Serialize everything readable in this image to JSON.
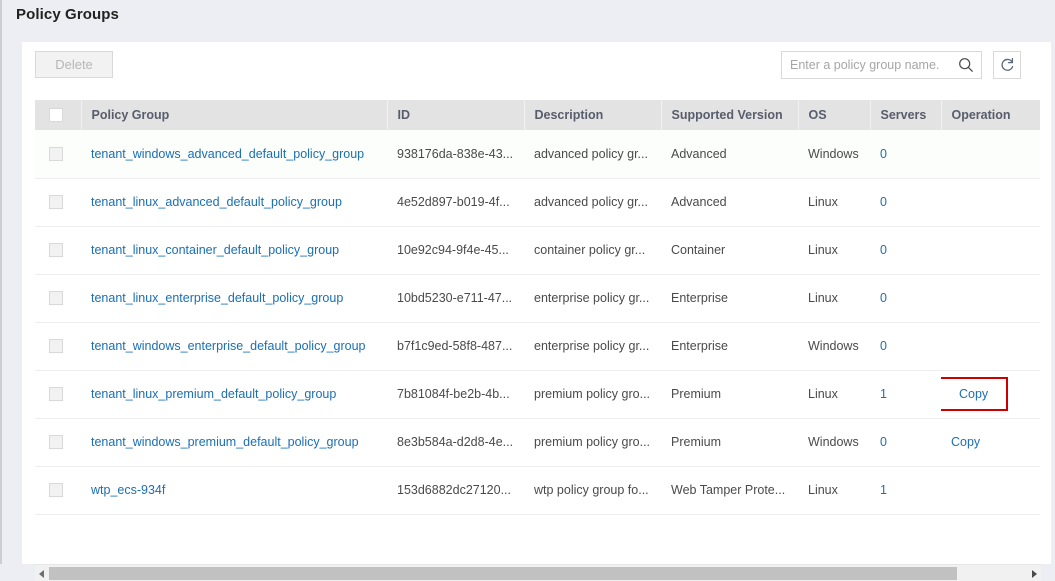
{
  "page": {
    "title": "Policy Groups"
  },
  "toolbar": {
    "delete_label": "Delete",
    "search_placeholder": "Enter a policy group name.",
    "search_value": "",
    "search_icon": "search-icon",
    "refresh_icon": "refresh-icon"
  },
  "table": {
    "columns": [
      {
        "key": "checkbox",
        "label": ""
      },
      {
        "key": "name",
        "label": "Policy Group"
      },
      {
        "key": "id",
        "label": "ID"
      },
      {
        "key": "description",
        "label": "Description"
      },
      {
        "key": "version",
        "label": "Supported Version"
      },
      {
        "key": "os",
        "label": "OS"
      },
      {
        "key": "servers",
        "label": "Servers"
      },
      {
        "key": "operation",
        "label": "Operation"
      }
    ],
    "rows": [
      {
        "name": "tenant_windows_advanced_default_policy_group",
        "id": "938176da-838e-43...",
        "description": "advanced policy gr...",
        "version": "Advanced",
        "os": "Windows",
        "servers": "0",
        "operation": ""
      },
      {
        "name": "tenant_linux_advanced_default_policy_group",
        "id": "4e52d897-b019-4f...",
        "description": "advanced policy gr...",
        "version": "Advanced",
        "os": "Linux",
        "servers": "0",
        "operation": ""
      },
      {
        "name": "tenant_linux_container_default_policy_group",
        "id": "10e92c94-9f4e-45...",
        "description": "container policy gr...",
        "version": "Container",
        "os": "Linux",
        "servers": "0",
        "operation": ""
      },
      {
        "name": "tenant_linux_enterprise_default_policy_group",
        "id": "10bd5230-e711-47...",
        "description": "enterprise policy gr...",
        "version": "Enterprise",
        "os": "Linux",
        "servers": "0",
        "operation": ""
      },
      {
        "name": "tenant_windows_enterprise_default_policy_group",
        "id": "b7f1c9ed-58f8-487...",
        "description": "enterprise policy gr...",
        "version": "Enterprise",
        "os": "Windows",
        "servers": "0",
        "operation": ""
      },
      {
        "name": "tenant_linux_premium_default_policy_group",
        "id": "7b81084f-be2b-4b...",
        "description": "premium policy gro...",
        "version": "Premium",
        "os": "Linux",
        "servers": "1",
        "operation": "Copy"
      },
      {
        "name": "tenant_windows_premium_default_policy_group",
        "id": "8e3b584a-d2d8-4e...",
        "description": "premium policy gro...",
        "version": "Premium",
        "os": "Windows",
        "servers": "0",
        "operation": "Copy"
      },
      {
        "name": "wtp_ecs-934f",
        "id": "153d6882dc27120...",
        "description": "wtp policy group fo...",
        "version": "Web Tamper Prote...",
        "os": "Linux",
        "servers": "1",
        "operation": ""
      }
    ]
  },
  "colors": {
    "link": "#1a6fb5",
    "highlight": "#cc0000",
    "page_bg": "#eceef3",
    "header_bg": "#e3e3e3"
  }
}
